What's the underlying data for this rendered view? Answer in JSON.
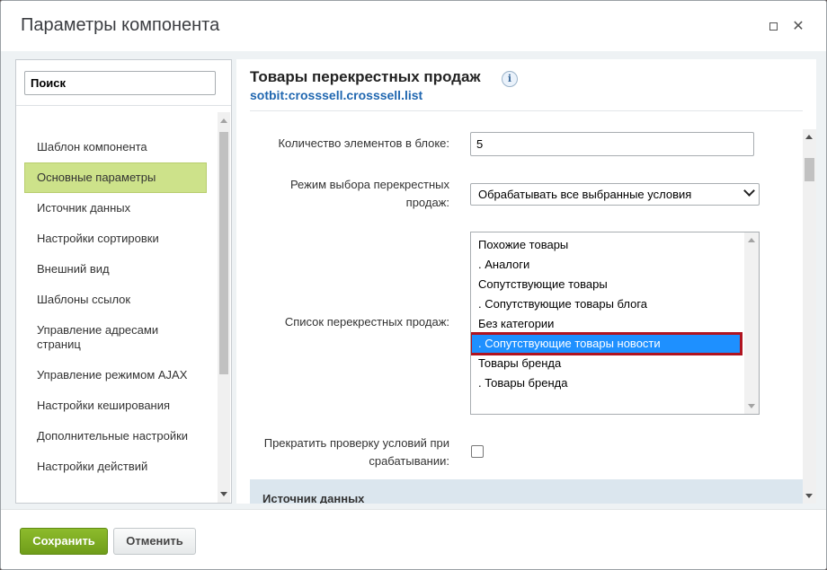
{
  "window": {
    "title": "Параметры компонента",
    "minimize_icon": "restore-icon",
    "close_icon": "close-icon"
  },
  "sidebar": {
    "search_placeholder": "Поиск",
    "items": [
      {
        "label": "Шаблон компонента"
      },
      {
        "label": "Основные параметры",
        "active": true
      },
      {
        "label": "Источник данных"
      },
      {
        "label": "Настройки сортировки"
      },
      {
        "label": "Внешний вид"
      },
      {
        "label": "Шаблоны ссылок"
      },
      {
        "label": "Управление адресами страниц"
      },
      {
        "label": "Управление режимом AJAX"
      },
      {
        "label": "Настройки кеширования"
      },
      {
        "label": "Дополнительные настройки"
      },
      {
        "label": "Настройки действий"
      }
    ]
  },
  "component": {
    "title": "Товары перекрестных продаж",
    "code": "sotbit:crosssell.crosssell.list",
    "info_icon_glyph": "i"
  },
  "fields": {
    "count_label": "Количество элементов в блоке:",
    "count_value": "5",
    "mode_label": "Режим выбора перекрестных продаж:",
    "mode_value": "Обрабатывать все выбранные условия",
    "list_label": "Список перекрестных продаж:",
    "list_options": [
      {
        "label": "Похожие товары"
      },
      {
        "label": ". Аналоги"
      },
      {
        "label": "Сопутствующие товары"
      },
      {
        "label": ". Сопутствующие товары блога"
      },
      {
        "label": "Без категории"
      },
      {
        "label": ". Сопутствующие товары новости",
        "selected": true
      },
      {
        "label": "Товары бренда"
      },
      {
        "label": ". Товары бренда"
      }
    ],
    "stop_label": "Прекратить проверку условий при срабатывании:",
    "stop_checked": false
  },
  "section": {
    "next_title": "Источник данных"
  },
  "footer": {
    "save_label": "Сохранить",
    "cancel_label": "Отменить"
  },
  "colors": {
    "accent_green": "#7aab21",
    "active_item_bg": "#cde28a",
    "selection_blue": "#1e90ff",
    "highlight_red": "#b01420",
    "link_blue": "#2067b0"
  }
}
